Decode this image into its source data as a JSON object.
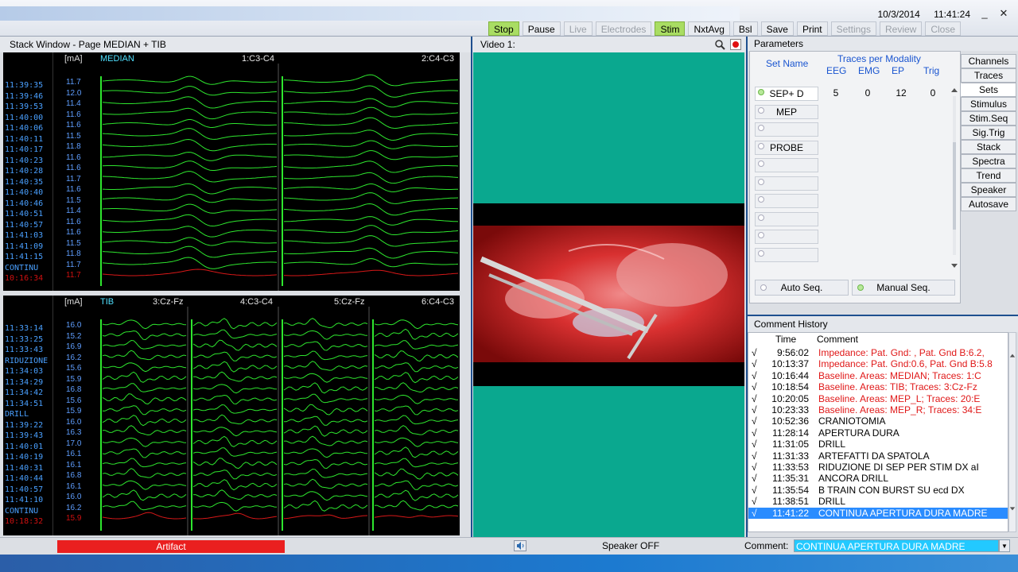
{
  "header": {
    "date": "10/3/2014",
    "time": "11:41:24",
    "window_controls": [
      "minimize-icon",
      "close-icon"
    ],
    "toolbar": [
      {
        "id": "stop",
        "label": "Stop",
        "state": "active"
      },
      {
        "id": "pause",
        "label": "Pause",
        "state": "normal"
      },
      {
        "id": "live",
        "label": "Live",
        "state": "disabled"
      },
      {
        "id": "electrodes",
        "label": "Electrodes",
        "state": "disabled"
      },
      {
        "id": "stim",
        "label": "Stim",
        "state": "active"
      },
      {
        "id": "nxtavg",
        "label": "NxtAvg",
        "state": "normal"
      },
      {
        "id": "bsl",
        "label": "Bsl",
        "state": "normal"
      },
      {
        "id": "save",
        "label": "Save",
        "state": "normal"
      },
      {
        "id": "print",
        "label": "Print",
        "state": "normal"
      },
      {
        "id": "settings",
        "label": "Settings",
        "state": "disabled"
      },
      {
        "id": "review",
        "label": "Review",
        "state": "disabled"
      },
      {
        "id": "close",
        "label": "Close",
        "state": "disabled"
      }
    ]
  },
  "stack": {
    "title": "Stack Window - Page MEDIAN + TIB",
    "top": {
      "unit": "[mA]",
      "area": "MEDIAN",
      "channels": [
        "1:C3-C4",
        "2:C4-C3"
      ],
      "times": [
        "11:39:35",
        "11:39:46",
        "11:39:53",
        "11:40:00",
        "11:40:06",
        "11:40:11",
        "11:40:17",
        "11:40:23",
        "11:40:28",
        "11:40:35",
        "11:40:40",
        "11:40:46",
        "11:40:51",
        "11:40:57",
        "11:41:03",
        "11:41:09",
        "11:41:15",
        "CONTINU",
        "10:16:34"
      ],
      "values": [
        "11.7",
        "12.0",
        "11.4",
        "11.6",
        "11.6",
        "11.5",
        "11.8",
        "11.6",
        "11.6",
        "11.7",
        "11.6",
        "11.5",
        "11.4",
        "11.6",
        "11.6",
        "11.5",
        "11.8",
        "11.7",
        "11.7"
      ]
    },
    "bottom": {
      "unit": "[mA]",
      "area": "TIB",
      "channels": [
        "3:Cz-Fz",
        "4:C3-C4",
        "5:Cz-Fz",
        "6:C4-C3"
      ],
      "times": [
        "11:33:14",
        "11:33:25",
        "11:33:43",
        "RIDUZIONE",
        "11:34:03",
        "11:34:29",
        "11:34:42",
        "11:34:51",
        "DRILL",
        "11:39:22",
        "11:39:43",
        "11:40:01",
        "11:40:19",
        "11:40:31",
        "11:40:44",
        "11:40:57",
        "11:41:10",
        "CONTINU",
        "10:18:32"
      ],
      "values": [
        "16.0",
        "15.2",
        "16.9",
        "16.2",
        "15.6",
        "15.9",
        "16.8",
        "15.6",
        "15.9",
        "16.0",
        "16.3",
        "17.0",
        "16.1",
        "16.1",
        "16.8",
        "16.1",
        "16.0",
        "16.2",
        "15.9"
      ]
    },
    "colors": {
      "trace": "#2ee62e",
      "baseline": "#d81818"
    }
  },
  "video": {
    "title": "Video 1:"
  },
  "parameters": {
    "title": "Parameters",
    "set_name_header": "Set Name",
    "traces_header": "Traces per Modality",
    "modalities": [
      "EEG",
      "EMG",
      "EP",
      "Trig"
    ],
    "sets": [
      {
        "name": "SEP+ D",
        "counts": [
          "5",
          "0",
          "12",
          "0"
        ],
        "selected": true,
        "dim": false
      },
      {
        "name": "MEP",
        "counts": [
          "",
          "",
          "",
          ""
        ],
        "selected": false,
        "dim": true
      },
      {
        "name": "",
        "counts": [
          "",
          "",
          "",
          ""
        ],
        "selected": false,
        "dim": true
      },
      {
        "name": "PROBE",
        "counts": [
          "",
          "",
          "",
          ""
        ],
        "selected": false,
        "dim": true
      },
      {
        "name": "",
        "counts": [
          "",
          "",
          "",
          ""
        ],
        "selected": false,
        "dim": true
      },
      {
        "name": "",
        "counts": [
          "",
          "",
          "",
          ""
        ],
        "selected": false,
        "dim": true
      },
      {
        "name": "",
        "counts": [
          "",
          "",
          "",
          ""
        ],
        "selected": false,
        "dim": true
      },
      {
        "name": "",
        "counts": [
          "",
          "",
          "",
          ""
        ],
        "selected": false,
        "dim": true
      },
      {
        "name": "",
        "counts": [
          "",
          "",
          "",
          ""
        ],
        "selected": false,
        "dim": true
      },
      {
        "name": "",
        "counts": [
          "",
          "",
          "",
          ""
        ],
        "selected": false,
        "dim": true
      }
    ],
    "auto_seq": "Auto Seq.",
    "manual_seq": "Manual Seq.",
    "tabs": [
      "Channels",
      "Traces",
      "Sets",
      "Stimulus",
      "Stim.Seq",
      "Sig.Trig",
      "Stack",
      "Spectra",
      "Trend",
      "Speaker",
      "Autosave"
    ],
    "active_tab": "Sets"
  },
  "comment_history": {
    "title": "Comment History",
    "col_time": "Time",
    "col_comment": "Comment",
    "rows": [
      {
        "check": "√",
        "time": "9:56:02",
        "text": "Impedance: Pat. Gnd: , Pat. Gnd B:6.2,",
        "red": true
      },
      {
        "check": "√",
        "time": "10:13:37",
        "text": "Impedance: Pat. Gnd:0.6, Pat. Gnd B:5.8",
        "red": true
      },
      {
        "check": "√",
        "time": "10:16:44",
        "text": "Baseline. Areas: MEDIAN; Traces: 1:C",
        "red": true
      },
      {
        "check": "√",
        "time": "10:18:54",
        "text": "Baseline. Areas: TIB; Traces: 3:Cz-Fz",
        "red": true
      },
      {
        "check": "√",
        "time": "10:20:05",
        "text": "Baseline. Areas: MEP_L; Traces: 20:E",
        "red": true
      },
      {
        "check": "√",
        "time": "10:23:33",
        "text": "Baseline. Areas: MEP_R; Traces: 34:E",
        "red": true
      },
      {
        "check": "√",
        "time": "10:52:36",
        "text": "CRANIOTOMIA",
        "red": false
      },
      {
        "check": "√",
        "time": "11:28:14",
        "text": "APERTURA DURA",
        "red": false
      },
      {
        "check": "√",
        "time": "11:31:05",
        "text": "DRILL",
        "red": false
      },
      {
        "check": "√",
        "time": "11:31:33",
        "text": "ARTEFATTI DA SPATOLA",
        "red": false
      },
      {
        "check": "√",
        "time": "11:33:53",
        "text": "RIDUZIONE DI SEP PER STIM DX aI",
        "red": false
      },
      {
        "check": "√",
        "time": "11:35:31",
        "text": "ANCORA DRILL",
        "red": false
      },
      {
        "check": "√",
        "time": "11:35:54",
        "text": "B TRAIN CON BURST SU ecd DX",
        "red": false
      },
      {
        "check": "√",
        "time": "11:38:51",
        "text": "DRILL",
        "red": false
      },
      {
        "check": "√",
        "time": "11:41:22",
        "text": "CONTINUA APERTURA DURA MADRE",
        "red": false,
        "selected": true
      }
    ]
  },
  "status": {
    "artifact": "Artifact",
    "speaker": "Speaker OFF",
    "comment_label": "Comment:",
    "comment_value": "CONTINUA APERTURA DURA MADRE"
  }
}
